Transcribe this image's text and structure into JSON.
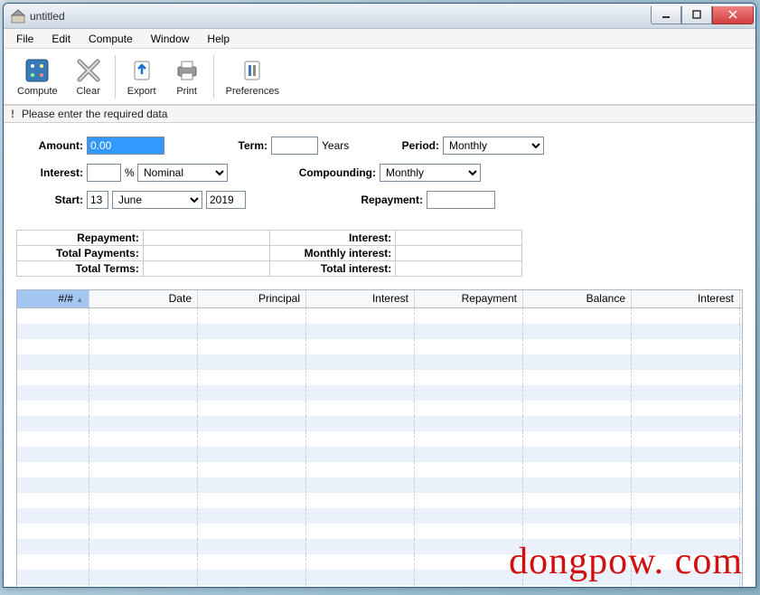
{
  "window": {
    "title": "untitled"
  },
  "menu": {
    "file": "File",
    "edit": "Edit",
    "compute": "Compute",
    "window": "Window",
    "help": "Help"
  },
  "toolbar": {
    "compute": "Compute",
    "clear": "Clear",
    "export": "Export",
    "print": "Print",
    "preferences": "Preferences"
  },
  "status": {
    "icon": "!",
    "message": "Please enter the required data"
  },
  "form": {
    "amount_label": "Amount:",
    "amount_value": "0.00",
    "term_label": "Term:",
    "term_value": "",
    "term_unit": "Years",
    "period_label": "Period:",
    "period_value": "Monthly",
    "interest_label": "Interest:",
    "interest_value": "",
    "interest_unit": "%",
    "interest_type_value": "Nominal",
    "compounding_label": "Compounding:",
    "compounding_value": "Monthly",
    "start_label": "Start:",
    "start_day": "13",
    "start_month": "June",
    "start_year": "2019",
    "repayment_label": "Repayment:",
    "repayment_value": ""
  },
  "summary": {
    "r1a": "Repayment:",
    "r1b": "Interest:",
    "r2a": "Total Payments:",
    "r2b": "Monthly interest:",
    "r3a": "Total Terms:",
    "r3b": "Total interest:"
  },
  "grid": {
    "columns": [
      "#/#",
      "Date",
      "Principal",
      "Interest",
      "Repayment",
      "Balance",
      "Interest"
    ]
  },
  "watermark": "dongpow. com"
}
